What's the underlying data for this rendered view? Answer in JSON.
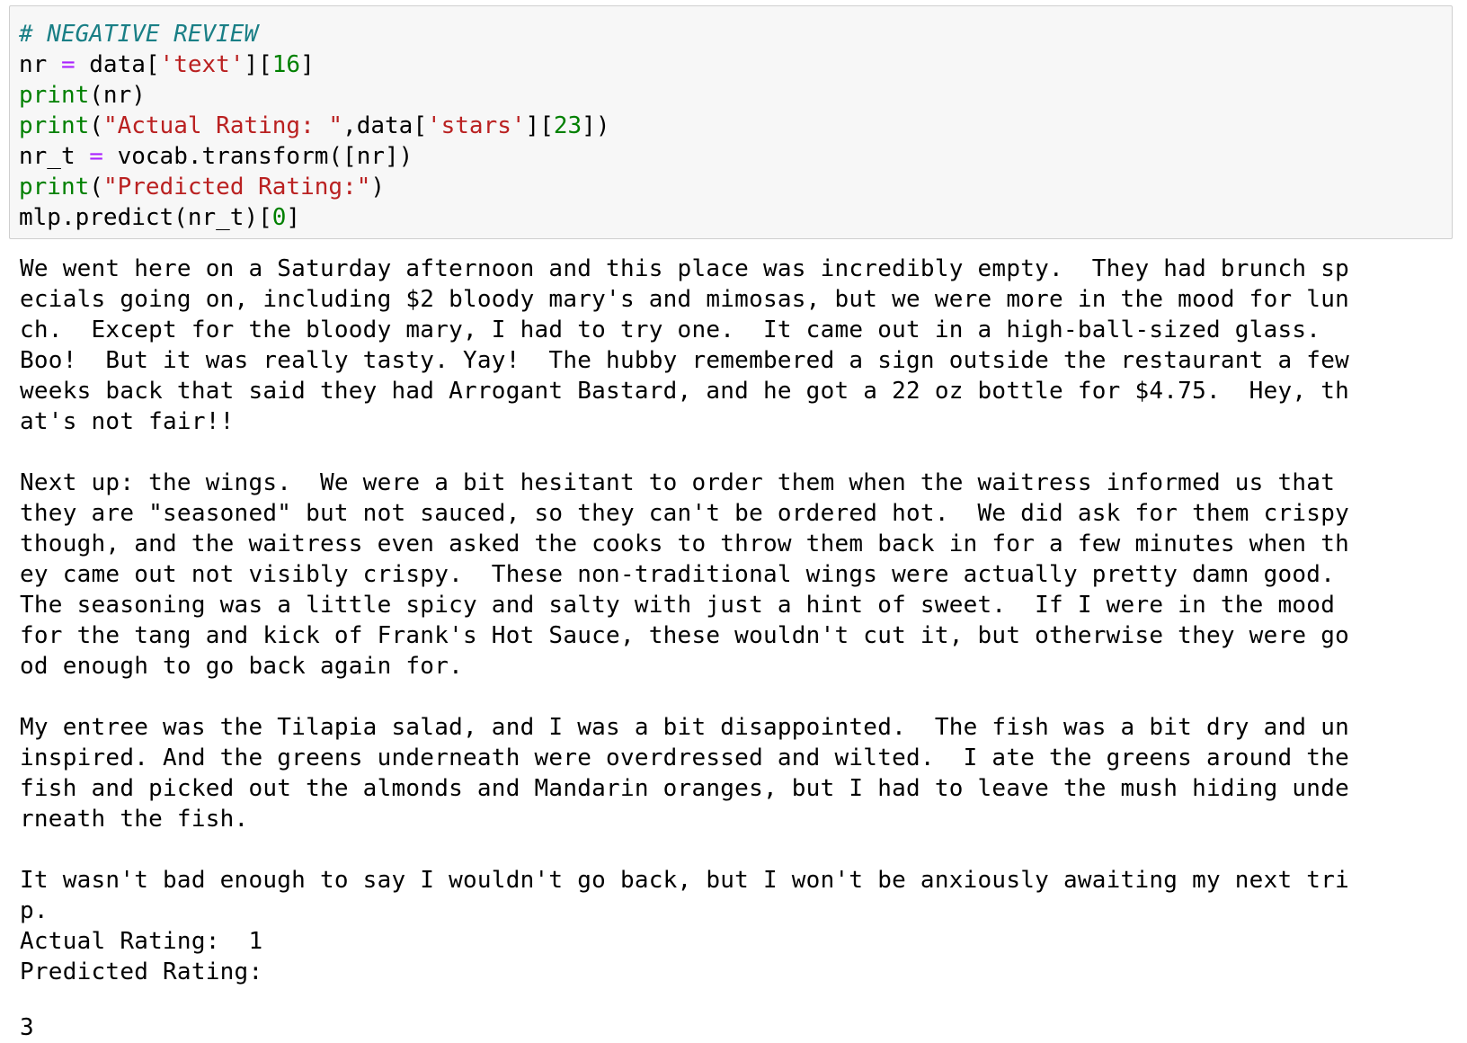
{
  "code_cell": {
    "lines": [
      {
        "tokens": [
          {
            "text": "# NEGATIVE REVIEW",
            "type": "comment"
          }
        ]
      },
      {
        "tokens": [
          {
            "text": "nr ",
            "type": "plain"
          },
          {
            "text": "=",
            "type": "op"
          },
          {
            "text": " data[",
            "type": "plain"
          },
          {
            "text": "'text'",
            "type": "string"
          },
          {
            "text": "][",
            "type": "plain"
          },
          {
            "text": "16",
            "type": "num"
          },
          {
            "text": "]",
            "type": "plain"
          }
        ]
      },
      {
        "tokens": [
          {
            "text": "print",
            "type": "builtin"
          },
          {
            "text": "(nr)",
            "type": "plain"
          }
        ]
      },
      {
        "tokens": [
          {
            "text": "print",
            "type": "builtin"
          },
          {
            "text": "(",
            "type": "plain"
          },
          {
            "text": "\"Actual Rating: \"",
            "type": "string"
          },
          {
            "text": ",data[",
            "type": "plain"
          },
          {
            "text": "'stars'",
            "type": "string"
          },
          {
            "text": "][",
            "type": "plain"
          },
          {
            "text": "23",
            "type": "num"
          },
          {
            "text": "])",
            "type": "plain"
          }
        ]
      },
      {
        "tokens": [
          {
            "text": "nr_t ",
            "type": "plain"
          },
          {
            "text": "=",
            "type": "op"
          },
          {
            "text": " vocab.transform([nr])",
            "type": "plain"
          }
        ]
      },
      {
        "tokens": [
          {
            "text": "print",
            "type": "builtin"
          },
          {
            "text": "(",
            "type": "plain"
          },
          {
            "text": "\"Predicted Rating:\"",
            "type": "string"
          },
          {
            "text": ")",
            "type": "plain"
          }
        ]
      },
      {
        "tokens": [
          {
            "text": "mlp.predict(nr_t)[",
            "type": "plain"
          },
          {
            "text": "0",
            "type": "num"
          },
          {
            "text": "]",
            "type": "plain"
          }
        ]
      }
    ]
  },
  "output": {
    "lines": [
      "We went here on a Saturday afternoon and this place was incredibly empty.  They had brunch sp",
      "ecials going on, including $2 bloody mary's and mimosas, but we were more in the mood for lun",
      "ch.  Except for the bloody mary, I had to try one.  It came out in a high-ball-sized glass.",
      "Boo!  But it was really tasty. Yay!  The hubby remembered a sign outside the restaurant a few",
      "weeks back that said they had Arrogant Bastard, and he got a 22 oz bottle for $4.75.  Hey, th",
      "at's not fair!!",
      "",
      "Next up: the wings.  We were a bit hesitant to order them when the waitress informed us that",
      "they are \"seasoned\" but not sauced, so they can't be ordered hot.  We did ask for them crispy",
      "though, and the waitress even asked the cooks to throw them back in for a few minutes when th",
      "ey came out not visibly crispy.  These non-traditional wings were actually pretty damn good.",
      "The seasoning was a little spicy and salty with just a hint of sweet.  If I were in the mood",
      "for the tang and kick of Frank's Hot Sauce, these wouldn't cut it, but otherwise they were go",
      "od enough to go back again for.",
      "",
      "My entree was the Tilapia salad, and I was a bit disappointed.  The fish was a bit dry and un",
      "inspired. And the greens underneath were overdressed and wilted.  I ate the greens around the",
      "fish and picked out the almonds and Mandarin oranges, but I had to leave the mush hiding unde",
      "rneath the fish.",
      "",
      "It wasn't bad enough to say I wouldn't go back, but I won't be anxiously awaiting my next tri",
      "p.",
      "Actual Rating:  1",
      "Predicted Rating:"
    ]
  },
  "result": {
    "value": "3"
  }
}
